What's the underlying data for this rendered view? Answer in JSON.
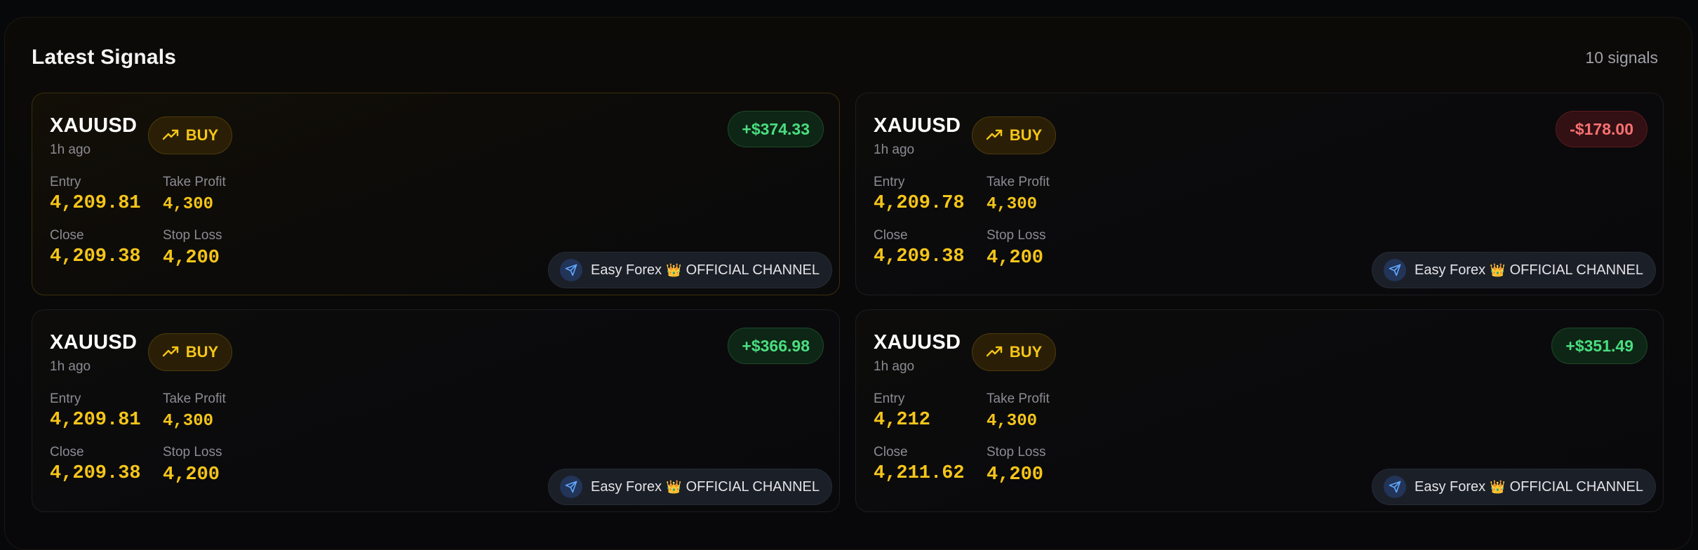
{
  "header": {
    "title": "Latest Signals",
    "count": "10 signals"
  },
  "labels": {
    "entry": "Entry",
    "take_profit": "Take Profit",
    "close": "Close",
    "stop_loss": "Stop Loss"
  },
  "colors": {
    "accent": "#f5c518",
    "profit": "#4ade80",
    "loss": "#f87171",
    "background": "#07080a"
  },
  "icons": {
    "direction": "trending-up-icon",
    "channel": "telegram-send-icon",
    "crown": "crown-icon"
  },
  "signals": [
    {
      "symbol": "XAUUSD",
      "time": "1h ago",
      "direction": "BUY",
      "pnl": "+$374.33",
      "pnl_status": "profit",
      "entry": "4,209.81",
      "take_profit": "4,300",
      "close": "4,209.38",
      "stop_loss": "4,200",
      "channel_name": "Easy Forex",
      "channel_suffix": "OFFICIAL CHANNEL",
      "channel_emoji": "👑"
    },
    {
      "symbol": "XAUUSD",
      "time": "1h ago",
      "direction": "BUY",
      "pnl": "-$178.00",
      "pnl_status": "loss",
      "entry": "4,209.78",
      "take_profit": "4,300",
      "close": "4,209.38",
      "stop_loss": "4,200",
      "channel_name": "Easy Forex",
      "channel_suffix": "OFFICIAL CHANNEL",
      "channel_emoji": "👑"
    },
    {
      "symbol": "XAUUSD",
      "time": "1h ago",
      "direction": "BUY",
      "pnl": "+$366.98",
      "pnl_status": "profit",
      "entry": "4,209.81",
      "take_profit": "4,300",
      "close": "4,209.38",
      "stop_loss": "4,200",
      "channel_name": "Easy Forex",
      "channel_suffix": "OFFICIAL CHANNEL",
      "channel_emoji": "👑"
    },
    {
      "symbol": "XAUUSD",
      "time": "1h ago",
      "direction": "BUY",
      "pnl": "+$351.49",
      "pnl_status": "profit",
      "entry": "4,212",
      "take_profit": "4,300",
      "close": "4,211.62",
      "stop_loss": "4,200",
      "channel_name": "Easy Forex",
      "channel_suffix": "OFFICIAL CHANNEL",
      "channel_emoji": "👑"
    }
  ]
}
